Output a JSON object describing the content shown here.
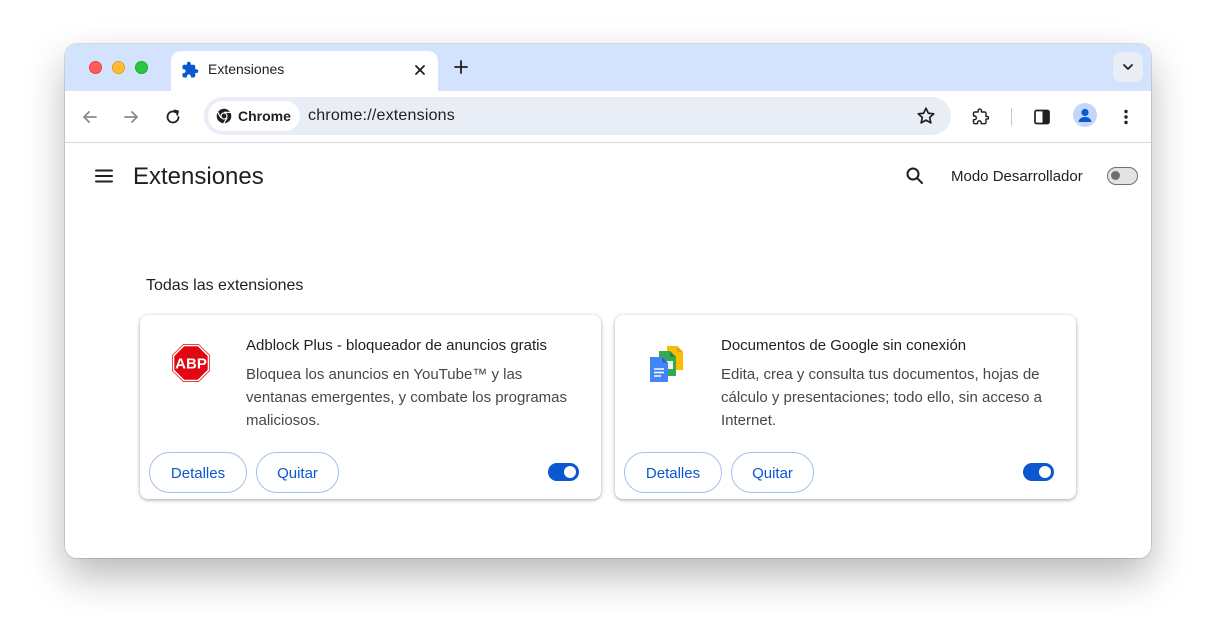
{
  "tab": {
    "title": "Extensiones"
  },
  "omnibox": {
    "chip_label": "Chrome",
    "url": "chrome://extensions"
  },
  "page": {
    "title": "Extensiones",
    "dev_mode_label": "Modo Desarrollador",
    "dev_mode_enabled": false,
    "section_title": "Todas las extensiones"
  },
  "extensions": [
    {
      "name": "Adblock Plus - bloqueador de anuncios gratis",
      "description": "Bloquea los anuncios en YouTube™ y las ventanas emergentes, y combate los programas maliciosos.",
      "details_label": "Detalles",
      "remove_label": "Quitar",
      "enabled": true,
      "icon": "adblock-plus-icon",
      "icon_text": "ABP"
    },
    {
      "name": "Documentos de Google sin conexión",
      "description": "Edita, crea y consulta tus documentos, hojas de cálculo y presentaciones; todo ello, sin acceso a Internet.",
      "details_label": "Detalles",
      "remove_label": "Quitar",
      "enabled": true,
      "icon": "google-docs-offline-icon"
    }
  ],
  "colors": {
    "accent": "#0b57d0",
    "tabstrip": "#d3e3fd",
    "omnibox": "#e9eef6",
    "abp_red": "#e30613"
  }
}
